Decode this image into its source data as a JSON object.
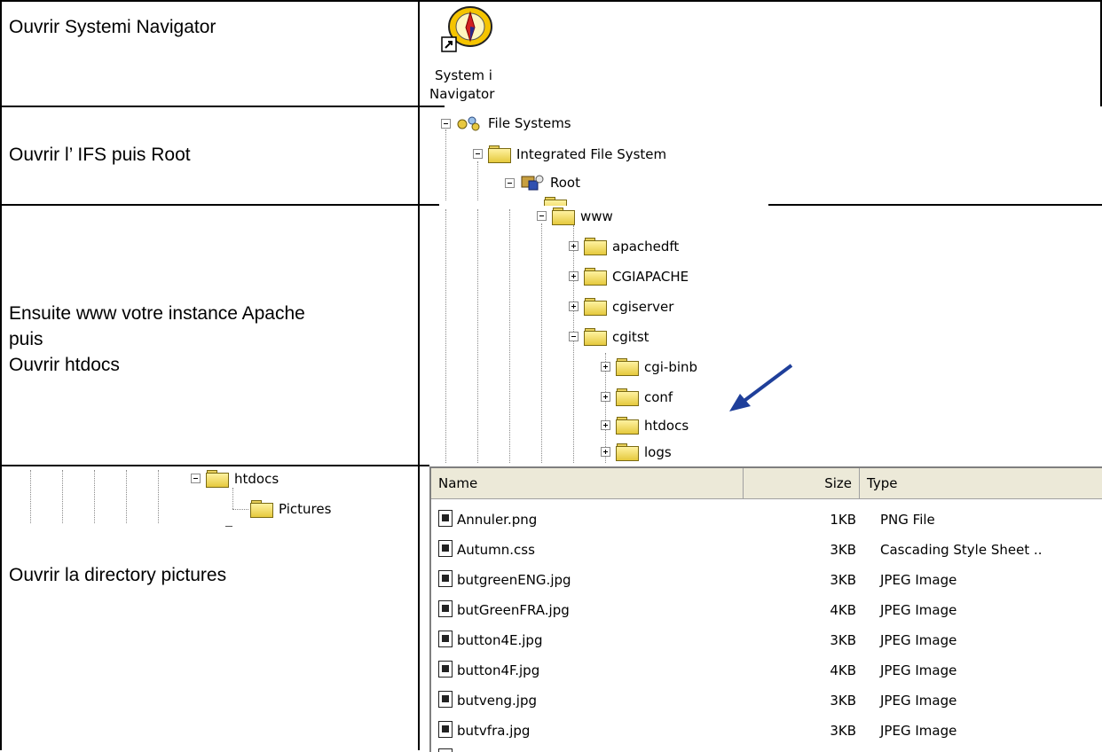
{
  "steps": [
    {
      "text_lines": [
        "Ouvrir Systemi Navigator"
      ]
    },
    {
      "text_lines": [
        "Ouvrir l’ IFS puis Root"
      ]
    },
    {
      "text_lines": [
        "Ensuite www votre instance Apache",
        "puis",
        "Ouvrir htdocs"
      ]
    },
    {
      "text_lines": [
        "Ouvrir la directory pictures"
      ]
    }
  ],
  "desktop_icon": {
    "label_line1": "System i",
    "label_line2": "Navigator",
    "icon": "compass-icon"
  },
  "tree1": {
    "file_systems": "File Systems",
    "ifs": "Integrated File System",
    "root": "Root"
  },
  "tree2": {
    "www": "www",
    "items": [
      "apachedft",
      "CGIAPACHE",
      "cgiserver",
      "cgitst"
    ],
    "cgitst_children": [
      "cgi-binb",
      "conf",
      "htdocs",
      "logs"
    ]
  },
  "tree3": {
    "htdocs": "htdocs",
    "pictures": "Pictures"
  },
  "file_list": {
    "columns": {
      "name": "Name",
      "size": "Size",
      "type": "Type"
    },
    "rows": [
      {
        "name": "Annuler.png",
        "size": "1KB",
        "type": "PNG File"
      },
      {
        "name": "Autumn.css",
        "size": "3KB",
        "type": "Cascading Style Sheet .."
      },
      {
        "name": "butgreenENG.jpg",
        "size": "3KB",
        "type": "JPEG Image"
      },
      {
        "name": "butGreenFRA.jpg",
        "size": "4KB",
        "type": "JPEG Image"
      },
      {
        "name": "button4E.jpg",
        "size": "3KB",
        "type": "JPEG Image"
      },
      {
        "name": "button4F.jpg",
        "size": "4KB",
        "type": "JPEG Image"
      },
      {
        "name": "butveng.jpg",
        "size": "3KB",
        "type": "JPEG Image"
      },
      {
        "name": "butvfra.jpg",
        "size": "3KB",
        "type": "JPEG Image"
      }
    ]
  },
  "colors": {
    "arrow": "#1f3f9a",
    "folder": "#f0d860",
    "header_bg": "#ece9d8"
  }
}
